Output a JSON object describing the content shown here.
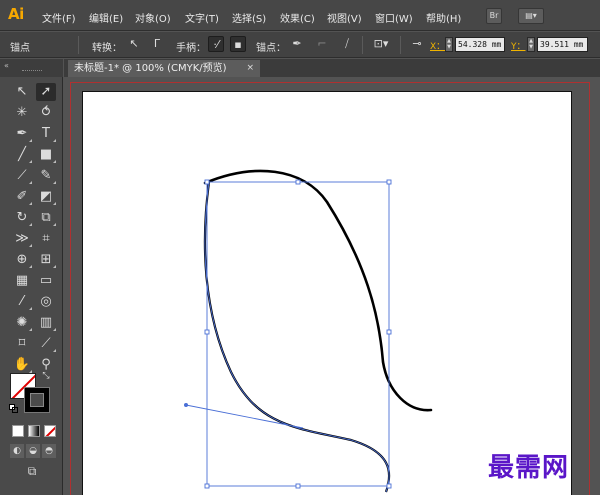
{
  "app": {
    "logo": "Ai"
  },
  "menu": [
    "文件(F)",
    "编辑(E)",
    "对象(O)",
    "文字(T)",
    "选择(S)",
    "效果(C)",
    "视图(V)",
    "窗口(W)",
    "帮助(H)"
  ],
  "menubar_buttons": {
    "bridge": "Br",
    "workspace": "▤▾"
  },
  "control": {
    "mode_label": "锚点",
    "convert_label": "转换：",
    "handles_label": "手柄：",
    "anchors_label": "锚点：",
    "x_label": "X：",
    "x_value": "54.328 mm",
    "y_label": "Y：",
    "y_value": "39.511 mm"
  },
  "document": {
    "tab_title": "未标题-1* @ 100% (CMYK/预览)",
    "close_glyph": "×"
  },
  "toolbar": {
    "collapse_glyph": "«"
  },
  "watermark": "最需网"
}
